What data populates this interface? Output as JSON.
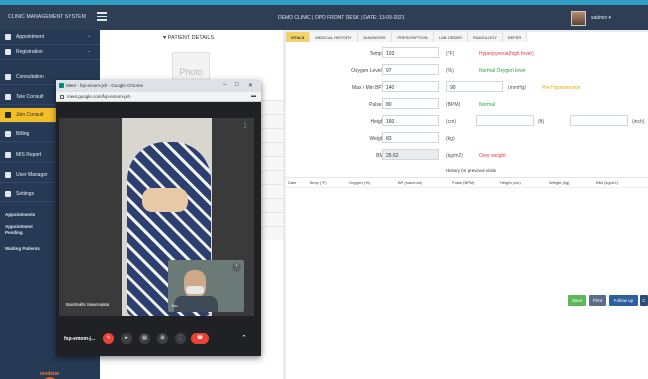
{
  "app": {
    "brand": "CLINIC MANAGEMENT SYSTEM",
    "center_title": "DEMO CLINIC | OPD FRONT DESK | DATE: 13-09-2021",
    "user": "sadmin ▾"
  },
  "sidebar": {
    "items": [
      {
        "label": "Appointment",
        "chev": "⌄"
      },
      {
        "label": "Registration",
        "chev": "⌄"
      },
      {
        "label": "Consultation",
        "chev": ""
      },
      {
        "label": "Tele Consult",
        "chev": ""
      },
      {
        "label": "Join Consult",
        "chev": ""
      },
      {
        "label": "Billing",
        "chev": ""
      },
      {
        "label": "MIS Report",
        "chev": ""
      },
      {
        "label": "User Manager",
        "chev": ""
      },
      {
        "label": "Settings",
        "chev": ""
      }
    ],
    "sub": [
      "Appointments",
      "Appointment Pending",
      "Waiting Patients"
    ],
    "logo_text": "medstar"
  },
  "patient": {
    "title": "♥ PATIENT DETAILS",
    "photo_label": "Photo"
  },
  "tabs": [
    "VITALS",
    "MEDICAL HISTORY",
    "DIAGNOSIS",
    "PRESCRIPTION",
    "LAB ORDER",
    "RADIOLOGY",
    "REFER"
  ],
  "vitals": {
    "temp": {
      "label": "Temp *",
      "value": "103",
      "unit": "(°F)",
      "status": "Hyperpyrexia(high fever)",
      "status_color": "#e03b3b"
    },
    "oxygen": {
      "label": "Oxygen Level *",
      "value": "97",
      "unit": "(%)",
      "status": "Normal Oxygen level",
      "status_color": "#2f9e44"
    },
    "bp": {
      "label": "Max / Min BP *",
      "max": "140",
      "min": "90",
      "unit": "(mmHg)",
      "status": "Pre Hypertension",
      "status_color": "#e6a800"
    },
    "pulse": {
      "label": "Pulse *",
      "value": "80",
      "unit": "(BPM)",
      "status": "Normal",
      "status_color": "#2f9e44"
    },
    "height": {
      "label": "Height",
      "value": "160",
      "unit": "(cm)",
      "ft_unit": "(ft)",
      "inch_unit": "(inch)"
    },
    "weight": {
      "label": "Weight",
      "value": "83",
      "unit": "(kg)"
    },
    "bmi": {
      "label": "BMI",
      "value": "25.62",
      "unit": "(kg/m2)",
      "status": "Over weight",
      "status_color": "#e03b3b"
    }
  },
  "history": {
    "title": "History for previous visits",
    "columns": [
      "Date",
      "Temp (°F)",
      "Oxygen (%)",
      "BP (max/min)",
      "Pulse (BPM)",
      "Height (cm)",
      "Weight (kg)",
      "BMI (kg/m2)"
    ]
  },
  "actions": {
    "save": "Save",
    "print": "Print",
    "followup": "Follow up",
    "close": "C"
  },
  "meet": {
    "window_title": "Meet - fxp-emom-jxh - Google Chrome",
    "url": "meet.google.com/fxp-emom-jxh",
    "participant": "Baishakhi Swarnalata",
    "self_label": "You",
    "meeting_code": "fxp-emom-j..."
  },
  "colors": {
    "sidebar": "#263a55",
    "active": "#f2bf2b",
    "desktop": "#2e9fc2"
  }
}
